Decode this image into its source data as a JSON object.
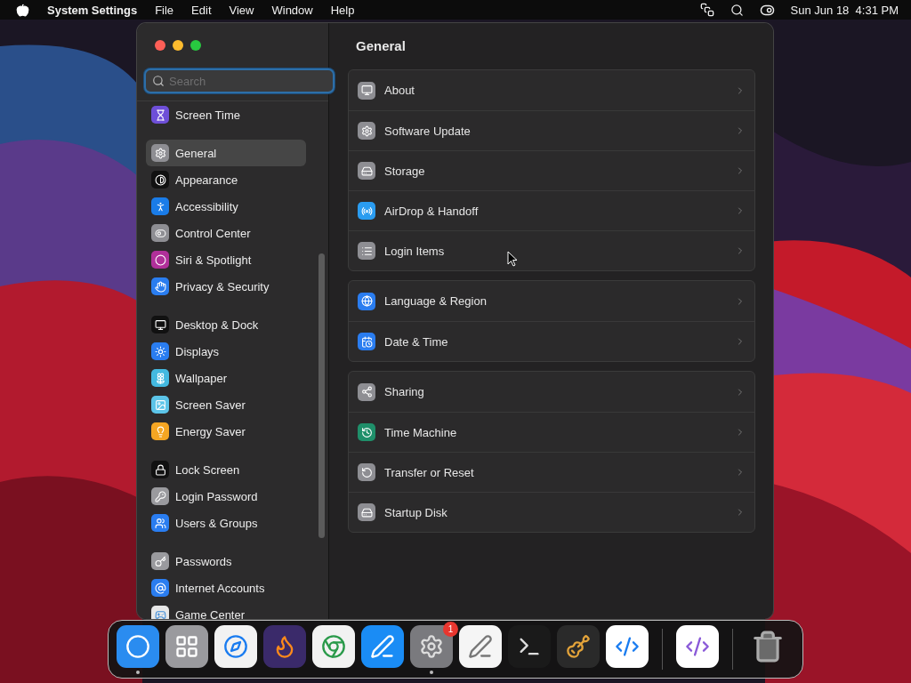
{
  "menu_bar": {
    "app_name": "System Settings",
    "menus": [
      "File",
      "Edit",
      "View",
      "Window",
      "Help"
    ],
    "clock": "Sun Jun 18  4:31 PM"
  },
  "window": {
    "search": {
      "placeholder": "Search"
    },
    "sidebar": {
      "sections": [
        {
          "items": [
            {
              "label": "Screen Time",
              "selected": false,
              "color": "#6e4fd8"
            }
          ]
        },
        {
          "items": [
            {
              "label": "General",
              "selected": true,
              "color": "#8e8e93"
            },
            {
              "label": "Appearance",
              "selected": false,
              "color": "#111111"
            },
            {
              "label": "Accessibility",
              "selected": false,
              "color": "#1a7ce8"
            },
            {
              "label": "Control Center",
              "selected": false,
              "color": "#8e8e93"
            },
            {
              "label": "Siri & Spotlight",
              "selected": false,
              "color": "#b0309a"
            },
            {
              "label": "Privacy & Security",
              "selected": false,
              "color": "#2a7df0"
            }
          ]
        },
        {
          "items": [
            {
              "label": "Desktop & Dock",
              "selected": false,
              "color": "#111111"
            },
            {
              "label": "Displays",
              "selected": false,
              "color": "#2a7df0"
            },
            {
              "label": "Wallpaper",
              "selected": false,
              "color": "#43b9e0"
            },
            {
              "label": "Screen Saver",
              "selected": false,
              "color": "#5cc4e8"
            },
            {
              "label": "Energy Saver",
              "selected": false,
              "color": "#f5a623"
            }
          ]
        },
        {
          "items": [
            {
              "label": "Lock Screen",
              "selected": false,
              "color": "#111111"
            },
            {
              "label": "Login Password",
              "selected": false,
              "color": "#9a9a9e"
            },
            {
              "label": "Users & Groups",
              "selected": false,
              "color": "#2a7df0"
            }
          ]
        },
        {
          "items": [
            {
              "label": "Passwords",
              "selected": false,
              "color": "#9a9a9e"
            },
            {
              "label": "Internet Accounts",
              "selected": false,
              "color": "#2a7df0"
            },
            {
              "label": "Game Center",
              "selected": false,
              "color": "#e8e8e8"
            }
          ]
        }
      ]
    },
    "content": {
      "title": "General",
      "groups": [
        {
          "rows": [
            {
              "label": "About",
              "color": "#8e8e93"
            },
            {
              "label": "Software Update",
              "color": "#8e8e93"
            },
            {
              "label": "Storage",
              "color": "#8e8e93"
            },
            {
              "label": "AirDrop & Handoff",
              "color": "#2a9cf0"
            },
            {
              "label": "Login Items",
              "color": "#8e8e93"
            }
          ]
        },
        {
          "rows": [
            {
              "label": "Language & Region",
              "color": "#2a7df0"
            },
            {
              "label": "Date & Time",
              "color": "#2a7df0"
            }
          ]
        },
        {
          "rows": [
            {
              "label": "Sharing",
              "color": "#8e8e93"
            },
            {
              "label": "Time Machine",
              "color": "#1f8f6a"
            },
            {
              "label": "Transfer or Reset",
              "color": "#8e8e93"
            },
            {
              "label": "Startup Disk",
              "color": "#8e8e93"
            }
          ]
        }
      ]
    }
  },
  "dock": {
    "items": [
      {
        "kind": "app",
        "running": true,
        "color": "#2a8cf0"
      },
      {
        "kind": "app",
        "running": false,
        "color": "#9a9a9e"
      },
      {
        "kind": "app",
        "running": false,
        "color": "#f2f2f2"
      },
      {
        "kind": "app",
        "running": false,
        "color": "#3a2a6a"
      },
      {
        "kind": "app",
        "running": false,
        "color": "#f2f2f2"
      },
      {
        "kind": "app",
        "running": false,
        "color": "#1a8cf5"
      },
      {
        "kind": "app",
        "running": true,
        "color": "#7a7a7e",
        "badge": "1"
      },
      {
        "kind": "app",
        "running": false,
        "color": "#f5f5f5"
      },
      {
        "kind": "app",
        "running": false,
        "color": "#1a1a1a"
      },
      {
        "kind": "app",
        "running": false,
        "color": "#2a2a2a"
      },
      {
        "kind": "app",
        "running": false,
        "color": "#ffffff"
      },
      {
        "kind": "divider"
      },
      {
        "kind": "app",
        "running": false,
        "color": "#ffffff"
      },
      {
        "kind": "divider"
      },
      {
        "kind": "trash",
        "running": false,
        "color": "#6a6a6a"
      }
    ]
  }
}
